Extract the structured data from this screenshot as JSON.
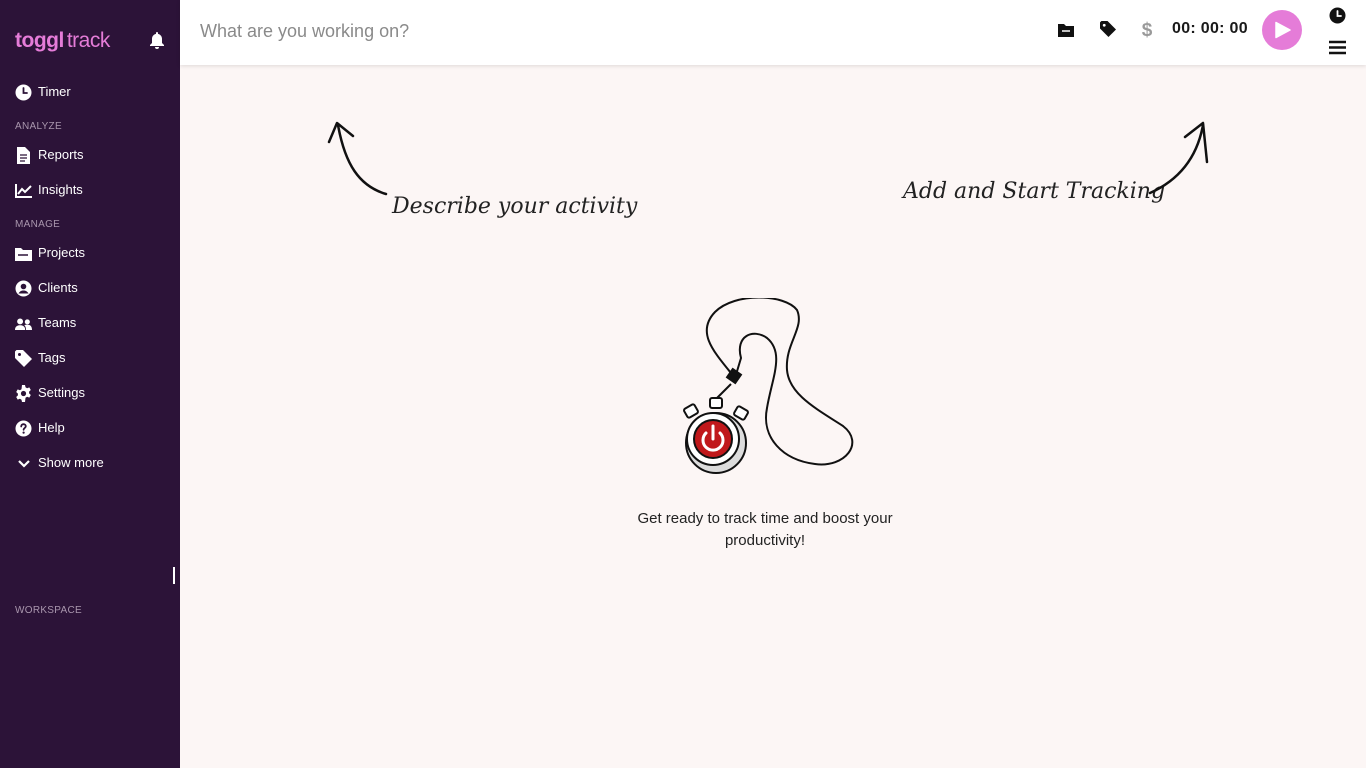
{
  "sidebar": {
    "logo": {
      "bold": "toggl",
      "light": "track"
    },
    "sections": {
      "analyze": "ANALYZE",
      "manage": "MANAGE",
      "workspace": "WORKSPACE"
    },
    "items": {
      "timer": "Timer",
      "reports": "Reports",
      "insights": "Insights",
      "projects": "Projects",
      "clients": "Clients",
      "teams": "Teams",
      "tags": "Tags",
      "settings": "Settings",
      "help": "Help",
      "show_more": "Show more"
    }
  },
  "topbar": {
    "placeholder": "What are you working on?",
    "timer": "00: 00: 00",
    "icons": [
      "folder-icon",
      "tag-icon",
      "dollar-icon",
      "play-icon",
      "clock-icon",
      "menu-icon"
    ],
    "dollar": "$"
  },
  "main": {
    "hint_left": "Describe your activity",
    "hint_right": "Add and Start Tracking",
    "empty_line1": "Get ready to track time and boost your",
    "empty_line2": "productivity!"
  },
  "colors": {
    "sidebar_bg": "#2c1338",
    "brand_pink": "#e57cd8",
    "main_bg": "#fcf6f5",
    "stopwatch_red": "#c0181b"
  }
}
